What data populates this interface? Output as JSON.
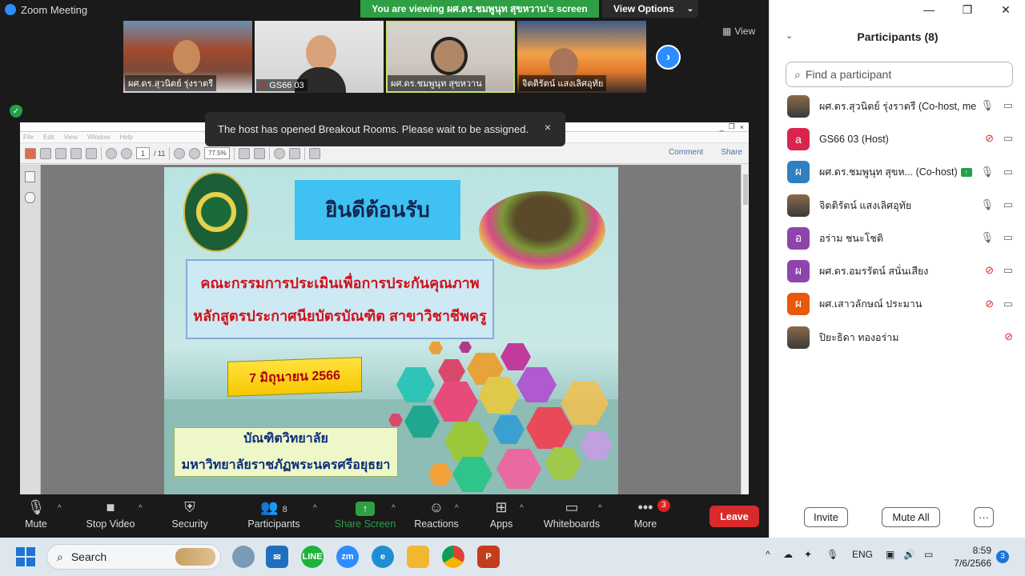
{
  "window": {
    "title": "Zoom Meeting",
    "viewing_banner": "You are viewing ผศ.ดร.ชมพูนุท  สุขหวาน's screen",
    "view_options": "View Options",
    "view_label": "View"
  },
  "thumbnails": [
    {
      "name": "ผศ.ดร.สุวนิตย์ รุ่งราตรี",
      "muted": false
    },
    {
      "name": "GS66 03",
      "muted": true
    },
    {
      "name": "ผศ.ดร.ชมพูนุท  สุขหวาน",
      "muted": false,
      "active": true
    },
    {
      "name": "จิตติรัตน์ แสงเลิศอุทัย",
      "muted": false
    }
  ],
  "toast": {
    "text": "The host has opened Breakout Rooms. Please wait to be assigned.",
    "close": "×"
  },
  "pdf": {
    "menu": [
      "File",
      "Edit",
      "View",
      "Window",
      "Help"
    ],
    "page_current": "1",
    "page_total": "/ 11",
    "zoom": "77.5%",
    "comment": "Comment",
    "share": "Share",
    "win_controls": [
      "_",
      "❐",
      "×"
    ]
  },
  "slide": {
    "welcome": "ยินดีต้อนรับ",
    "title_line1": "คณะกรรมการประเมินเพื่อการประกันคุณภาพ",
    "title_line2": "หลักสูตรประกาศนียบัตรบัณฑิต สาขาวิชาชีพครู",
    "date": "7 มิถุนายน 2566",
    "school_line1": "บัณฑิตวิทยาลัย",
    "school_line2": "มหาวิทยาลัยราชภัฏพระนครศรีอยุธยา"
  },
  "participants": {
    "title": "Participants (8)",
    "search_placeholder": "Find a participant",
    "list": [
      {
        "avatar": "",
        "avatar_color": "#6a4a3a",
        "name": "ผศ.ดร.สุวนิตย์ รุ่งราตรี (Co-host, me)",
        "mic": "on",
        "cam": "on",
        "photo": true
      },
      {
        "avatar": "a",
        "avatar_color": "#d9254d",
        "name": "GS66 03 (Host)",
        "mic": "off",
        "cam": "on",
        "photo": false
      },
      {
        "avatar": "ผ",
        "avatar_color": "#2f7fc1",
        "name": "ผศ.ดร.ชมพูนุท  สุขห...  (Co-host)",
        "mic": "on",
        "cam": "on",
        "photo": false,
        "sharing": true
      },
      {
        "avatar": "",
        "avatar_color": "#7a8a5a",
        "name": "จิตติรัตน์ แสงเลิศอุทัย",
        "mic": "on",
        "cam": "on",
        "photo": true
      },
      {
        "avatar": "อ",
        "avatar_color": "#8e44ad",
        "name": "อร่าม ชนะโชติ",
        "mic": "on",
        "cam": "on",
        "photo": false
      },
      {
        "avatar": "ผ",
        "avatar_color": "#8e44ad",
        "name": "ผศ.ดร.อมรรัตน์  สนั่นเสียง",
        "mic": "off",
        "cam": "on",
        "photo": false
      },
      {
        "avatar": "ผ",
        "avatar_color": "#e8590c",
        "name": "ผศ.เสาวลักษณ์ ประมาน",
        "mic": "off",
        "cam": "on",
        "photo": false
      },
      {
        "avatar": "",
        "avatar_color": "#5a6a7a",
        "name": "ปิยะธิดา ทองอร่าม",
        "mic": "none",
        "cam": "off",
        "photo": true
      }
    ],
    "invite": "Invite",
    "mute_all": "Mute All",
    "more": "···"
  },
  "toolbar": {
    "mute": "Mute",
    "stop_video": "Stop Video",
    "security": "Security",
    "participants": "Participants",
    "participants_count": "8",
    "share_screen": "Share Screen",
    "reactions": "Reactions",
    "apps": "Apps",
    "whiteboards": "Whiteboards",
    "more": "More",
    "more_badge": "3",
    "leave": "Leave"
  },
  "taskbar": {
    "search": "Search",
    "lang": "ENG",
    "time": "8:59",
    "date": "7/6/2566",
    "notifications": "3"
  }
}
